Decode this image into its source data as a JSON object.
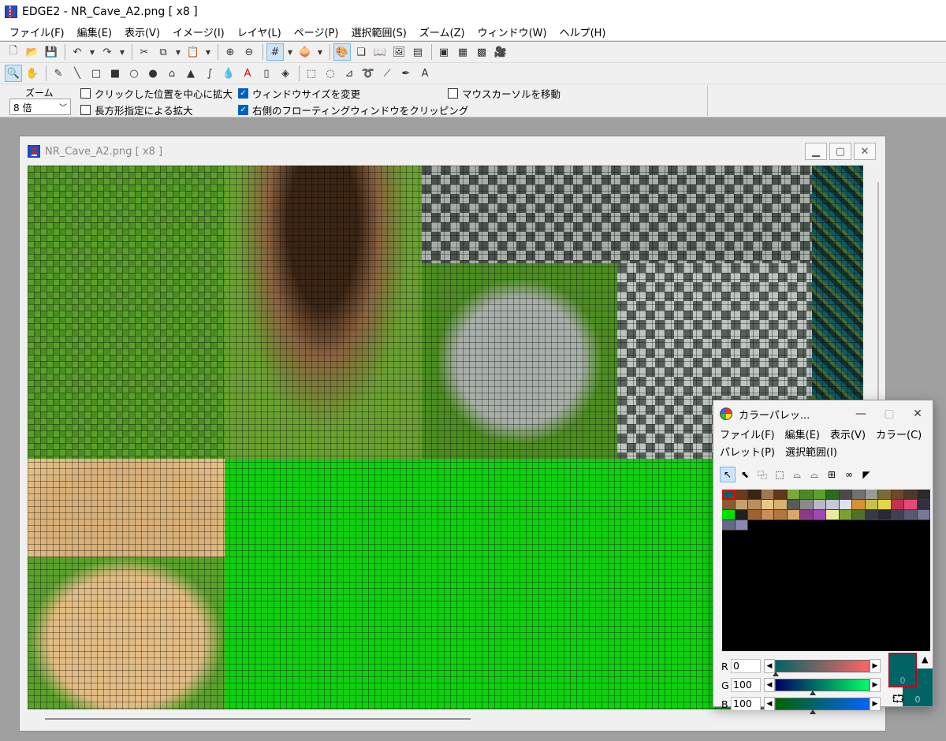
{
  "window": {
    "title": "EDGE2 - NR_Cave_A2.png [ x8 ]"
  },
  "menu": [
    "ファイル(F)",
    "編集(E)",
    "表示(V)",
    "イメージ(I)",
    "レイヤ(L)",
    "ページ(P)",
    "選択範囲(S)",
    "ズーム(Z)",
    "ウィンドウ(W)",
    "ヘルプ(H)"
  ],
  "toolbar1": [
    {
      "name": "new-file-icon",
      "glyph": "🗋"
    },
    {
      "name": "open-folder-icon",
      "glyph": "📂"
    },
    {
      "name": "save-icon",
      "glyph": "💾"
    },
    {
      "name": "undo-icon",
      "glyph": "↶"
    },
    {
      "name": "redo-icon",
      "glyph": "↷"
    },
    {
      "name": "cut-icon",
      "glyph": "✂"
    },
    {
      "name": "copy-icon",
      "glyph": "⧉"
    },
    {
      "name": "paste-icon",
      "glyph": "📋"
    },
    {
      "name": "zoom-in-icon",
      "glyph": "⊕"
    },
    {
      "name": "zoom-out-icon",
      "glyph": "⊖"
    },
    {
      "name": "grid-icon",
      "glyph": "#"
    },
    {
      "name": "onion-skin-icon",
      "glyph": "🧅"
    },
    {
      "name": "palette-window-icon",
      "glyph": "🎨"
    },
    {
      "name": "layer-window-icon",
      "glyph": "❏"
    },
    {
      "name": "book-icon",
      "glyph": "📖"
    },
    {
      "name": "preview-window-icon",
      "glyph": "🖼"
    },
    {
      "name": "info-window-icon",
      "glyph": "▤"
    },
    {
      "name": "sprite-tool-icon",
      "glyph": "▣"
    },
    {
      "name": "pattern-tool-icon",
      "glyph": "▦"
    },
    {
      "name": "frame-tool-icon",
      "glyph": "▩"
    },
    {
      "name": "animation-icon",
      "glyph": "🎥"
    }
  ],
  "toolbar2": [
    {
      "name": "zoom-tool-icon",
      "glyph": "🔍"
    },
    {
      "name": "hand-tool-icon",
      "glyph": "✋"
    },
    {
      "name": "pen-tool-icon",
      "glyph": "✎"
    },
    {
      "name": "line-tool-icon",
      "glyph": "╲"
    },
    {
      "name": "rectangle-tool-icon",
      "glyph": "□"
    },
    {
      "name": "filled-rectangle-tool-icon",
      "glyph": "■"
    },
    {
      "name": "ellipse-tool-icon",
      "glyph": "○"
    },
    {
      "name": "filled-ellipse-tool-icon",
      "glyph": "●"
    },
    {
      "name": "polygon-tool-icon",
      "glyph": "⌂"
    },
    {
      "name": "filled-polygon-tool-icon",
      "glyph": "▲"
    },
    {
      "name": "curve-tool-icon",
      "glyph": "∫"
    },
    {
      "name": "fill-tool-icon",
      "glyph": "💧"
    },
    {
      "name": "text-color-tool-icon",
      "glyph": "A"
    },
    {
      "name": "eraser-tool-icon",
      "glyph": "▯"
    },
    {
      "name": "bucket-tool-icon",
      "glyph": "◈"
    },
    {
      "name": "rect-select-tool-icon",
      "glyph": "⬚"
    },
    {
      "name": "ellipse-select-tool-icon",
      "glyph": "◌"
    },
    {
      "name": "poly-select-tool-icon",
      "glyph": "⊿"
    },
    {
      "name": "lasso-tool-icon",
      "glyph": "➰"
    },
    {
      "name": "magic-wand-tool-icon",
      "glyph": "⟋"
    },
    {
      "name": "eyedropper-tool-icon",
      "glyph": "✒"
    },
    {
      "name": "text-tool-icon",
      "glyph": "A"
    }
  ],
  "options": {
    "zoom_label": "ズーム",
    "zoom_value": "8 倍",
    "check_click_center": {
      "label": "クリックした位置を中心に拡大",
      "checked": false
    },
    "check_rect_zoom": {
      "label": "長方形指定による拡大",
      "checked": false
    },
    "check_resize_window": {
      "label": "ウィンドウサイズを変更",
      "checked": true
    },
    "check_clip_floating": {
      "label": "右側のフローティングウィンドウをクリッピング",
      "checked": true
    },
    "check_move_cursor": {
      "label": "マウスカーソルを移動",
      "checked": false
    }
  },
  "document": {
    "title": "NR_Cave_A2.png [ x8 ]"
  },
  "palette": {
    "title": "カラーパレッ...",
    "menu": [
      "ファイル(F)",
      "編集(E)",
      "表示(V)",
      "カラー(C)",
      "パレット(P)",
      "選択範囲(I)"
    ],
    "tools": [
      {
        "name": "select-arrow-icon",
        "glyph": "↖"
      },
      {
        "name": "select-cursor-icon",
        "glyph": "⬉"
      },
      {
        "name": "copy-range-icon",
        "glyph": "⿻"
      },
      {
        "name": "range-icon",
        "glyph": "⬚"
      },
      {
        "name": "gradient-icon",
        "glyph": "⌓"
      },
      {
        "name": "gradient2-icon",
        "glyph": "⌓"
      },
      {
        "name": "sort-icon",
        "glyph": "⊞"
      },
      {
        "name": "sync-icon",
        "glyph": "∞"
      },
      {
        "name": "transparent-color-icon",
        "glyph": "◤"
      }
    ],
    "swatches": [
      "#006464",
      "#6b3a20",
      "#3a2414",
      "#a07850",
      "#5a3a1a",
      "#7aa838",
      "#4c8a26",
      "#5aa02a",
      "#2d6a1e",
      "#4a4a4a",
      "#707070",
      "#9a9a9a",
      "#7a6a3a",
      "#6a4a2a",
      "#4a3a2a",
      "#2a2a2a",
      "#8a5a30",
      "#c8a070",
      "#b89060",
      "#e8c888",
      "#d8b070",
      "#5a5a5a",
      "#8a8a8a",
      "#b8b8c8",
      "#c8c8d8",
      "#e0e0f0",
      "#d89030",
      "#c8c048",
      "#e0d848",
      "#c83050",
      "#e84878",
      "#303040",
      "#00e000",
      "#202020",
      "#a06030",
      "#c89058",
      "#b07840",
      "#d8a868",
      "#8a3a8a",
      "#a048b0",
      "#e8e8a0",
      "#7aa030",
      "#507028",
      "#383848",
      "#282838",
      "#404050",
      "#585870",
      "#787898",
      "#686888",
      "#8888b0"
    ],
    "r": {
      "label": "R",
      "value": "0"
    },
    "g": {
      "label": "G",
      "value": "100"
    },
    "b": {
      "label": "B",
      "value": "100"
    },
    "fg_value": "0",
    "bg_value": "0"
  }
}
